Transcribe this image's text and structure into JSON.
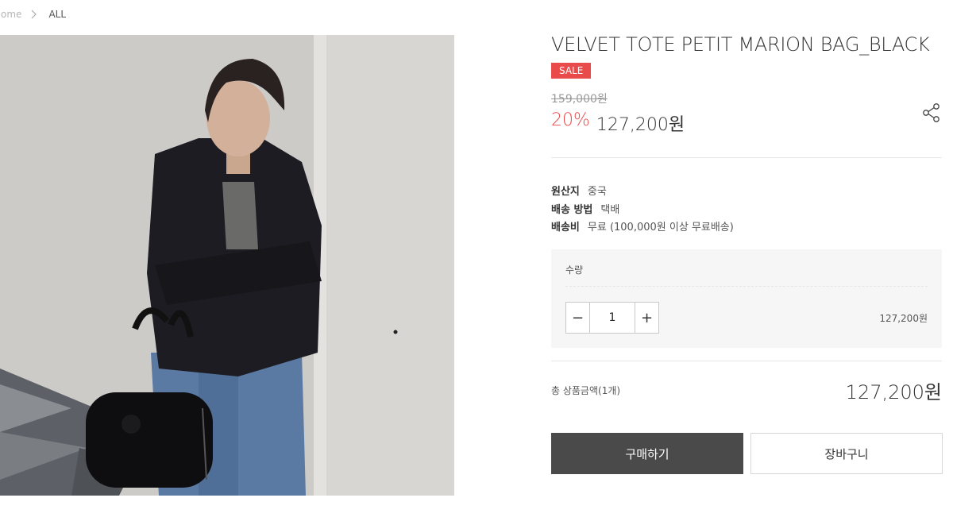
{
  "breadcrumb": {
    "home": "Home",
    "current": "ALL"
  },
  "product": {
    "title": "VELVET TOTE PETIT MARION BAG_BLACK",
    "badge": "SALE",
    "original_price": "159,000원",
    "discount": "20%",
    "price": "127,200원"
  },
  "specs": [
    {
      "key": "원산지",
      "value": "중국"
    },
    {
      "key": "배송 방법",
      "value": "택배"
    },
    {
      "key": "배송비",
      "value": "무료 (100,000원 이상 무료배송)"
    }
  ],
  "quantity": {
    "label": "수량",
    "value": "1",
    "minus": "−",
    "plus": "+",
    "subtotal": "127,200원"
  },
  "total": {
    "label": "총 상품금액(1개)",
    "value": "127,200원"
  },
  "actions": {
    "buy": "구매하기",
    "cart": "장바구니"
  },
  "colors": {
    "sale": "#e94b4b",
    "buy_bg": "#4a4a4a"
  },
  "icons": {
    "share": "share-icon",
    "breadcrumb_separator": "chevron-right-icon"
  }
}
